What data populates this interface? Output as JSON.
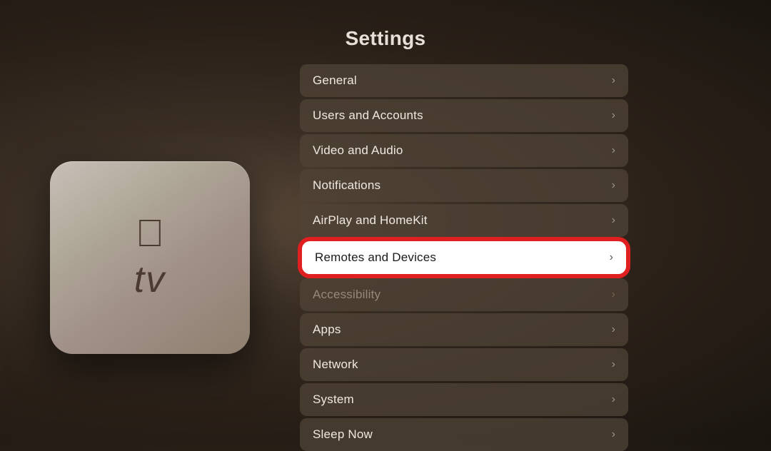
{
  "page": {
    "title": "Settings"
  },
  "device": {
    "apple_logo": "",
    "tv_text": "tv"
  },
  "settings_items": [
    {
      "id": "general",
      "label": "General",
      "active": false,
      "dimmed": false
    },
    {
      "id": "users-and-accounts",
      "label": "Users and Accounts",
      "active": false,
      "dimmed": false
    },
    {
      "id": "video-and-audio",
      "label": "Video and Audio",
      "active": false,
      "dimmed": false
    },
    {
      "id": "notifications",
      "label": "Notifications",
      "active": false,
      "dimmed": false
    },
    {
      "id": "airplay-and-homekit",
      "label": "AirPlay and HomeKit",
      "active": false,
      "dimmed": false
    },
    {
      "id": "remotes-and-devices",
      "label": "Remotes and Devices",
      "active": true,
      "dimmed": false
    },
    {
      "id": "accessibility",
      "label": "Accessibility",
      "active": false,
      "dimmed": true
    },
    {
      "id": "apps",
      "label": "Apps",
      "active": false,
      "dimmed": false
    },
    {
      "id": "network",
      "label": "Network",
      "active": false,
      "dimmed": false
    },
    {
      "id": "system",
      "label": "System",
      "active": false,
      "dimmed": false
    },
    {
      "id": "sleep-now",
      "label": "Sleep Now",
      "active": false,
      "dimmed": false
    }
  ]
}
